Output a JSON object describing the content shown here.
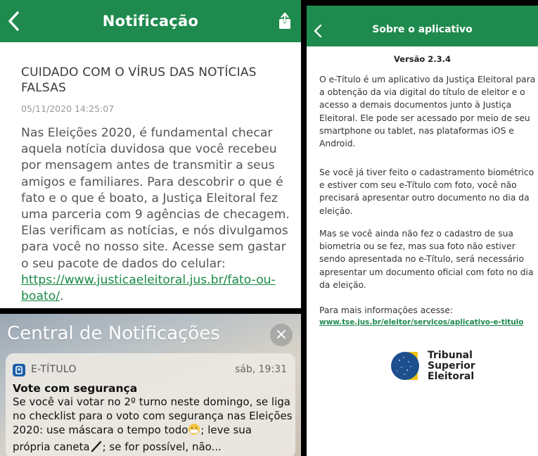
{
  "colors": {
    "header_green": "#1e8a4d",
    "link_green": "#1a8a46",
    "app_icon_blue": "#1d5fa8"
  },
  "left_top": {
    "header": {
      "title": "Notificação",
      "back_icon": "chevron-left-icon",
      "share_icon": "share-icon"
    },
    "headline": "CUIDADO COM O VÍRUS DAS NOTÍCIAS FALSAS",
    "date": "05/11/2020 14:25:07",
    "body": "Nas Eleições 2020, é fundamental checar aquela notícia duvidosa que você recebeu por mensagem antes de transmitir a seus amigos e familiares. Para descobrir o que é fato e o que é boato, a Justiça Eleitoral fez uma parceria com 9 agências de checagem. Elas verificam as notícias, e nós divulgamos para você no nosso site. Acesse sem gastar o seu pacote de dados do celular:",
    "link": "https://www.justicaeleitoral.jus.br/fato-ou-boato/",
    "link_suffix": "."
  },
  "left_bottom": {
    "title": "Central de Notificações",
    "close_label": "×",
    "notification": {
      "app_name": "E-TÍTULO",
      "time": "sáb, 19:31",
      "title": "Vote com segurança",
      "body_part1": "Se você vai votar no 2º turno neste domingo, se liga no checklist para o voto com segurança nas Eleições 2020: use máscara o tempo todo",
      "emoji1": "😷",
      "body_part2": "; leve sua própria caneta",
      "emoji2": "🖊",
      "body_part3": "; se for possível, não..."
    }
  },
  "right": {
    "header": {
      "title": "Sobre o aplicativo",
      "back_icon": "chevron-left-icon"
    },
    "version": "Versão 2.3.4",
    "paragraph1": "O e-Título é um aplicativo da Justiça Eleitoral para a obtenção da via digital do título de eleitor e o acesso a demais documentos junto à Justiça Eleitoral. Ele pode ser acessado por meio de seu smartphone ou tablet, nas plataformas iOS e Android.",
    "paragraph2": "Se você já tiver feito o cadastramento biométrico e estiver com seu e-Título com foto, você não precisará apresentar outro documento no dia da eleição.",
    "paragraph3": "Mas se você ainda não fez o cadastro de sua biometria ou se fez, mas sua foto não estiver sendo apresentada no e-Título, será necessário apresentar um documento oficial com foto no dia da eleição.",
    "more_info": "Para mais informações acesse:",
    "link": "www.tse.jus.br/eleitor/servicos/aplicativo-e-titulo",
    "logo": {
      "line1": "Tribunal",
      "line2": "Superior",
      "line3": "Eleitoral"
    }
  }
}
